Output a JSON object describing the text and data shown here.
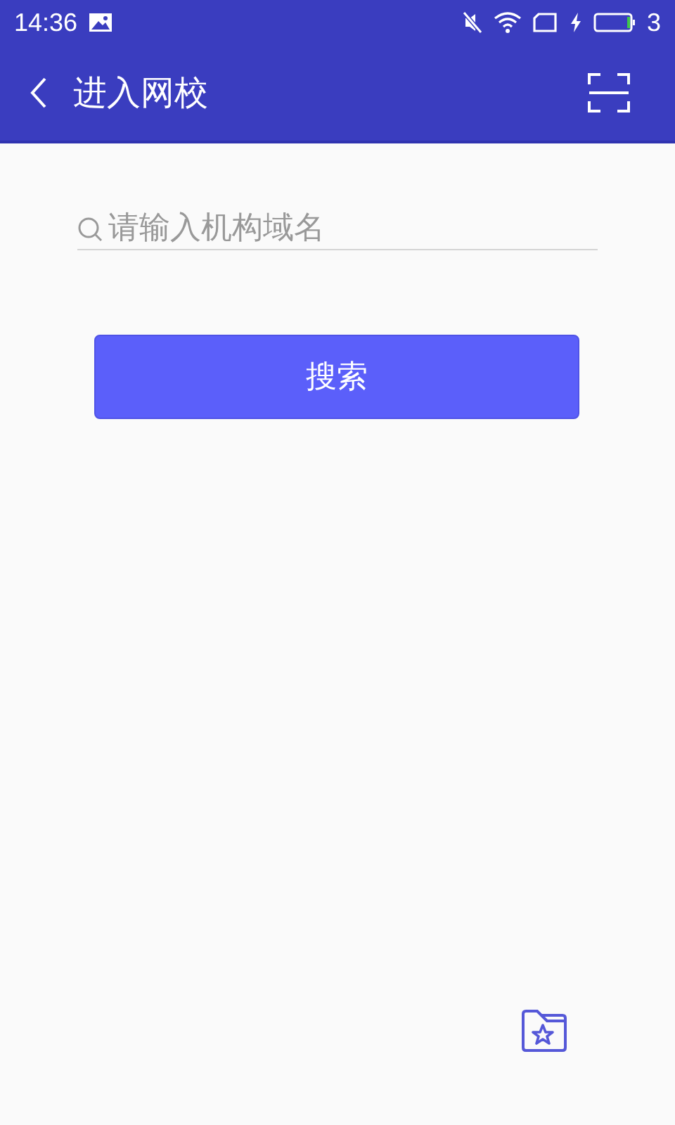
{
  "status_bar": {
    "time": "14:36",
    "battery_text": "3"
  },
  "app_bar": {
    "title": "进入网校"
  },
  "search": {
    "placeholder": "请输入机构域名"
  },
  "buttons": [
    {
      "label": "搜索"
    }
  ]
}
